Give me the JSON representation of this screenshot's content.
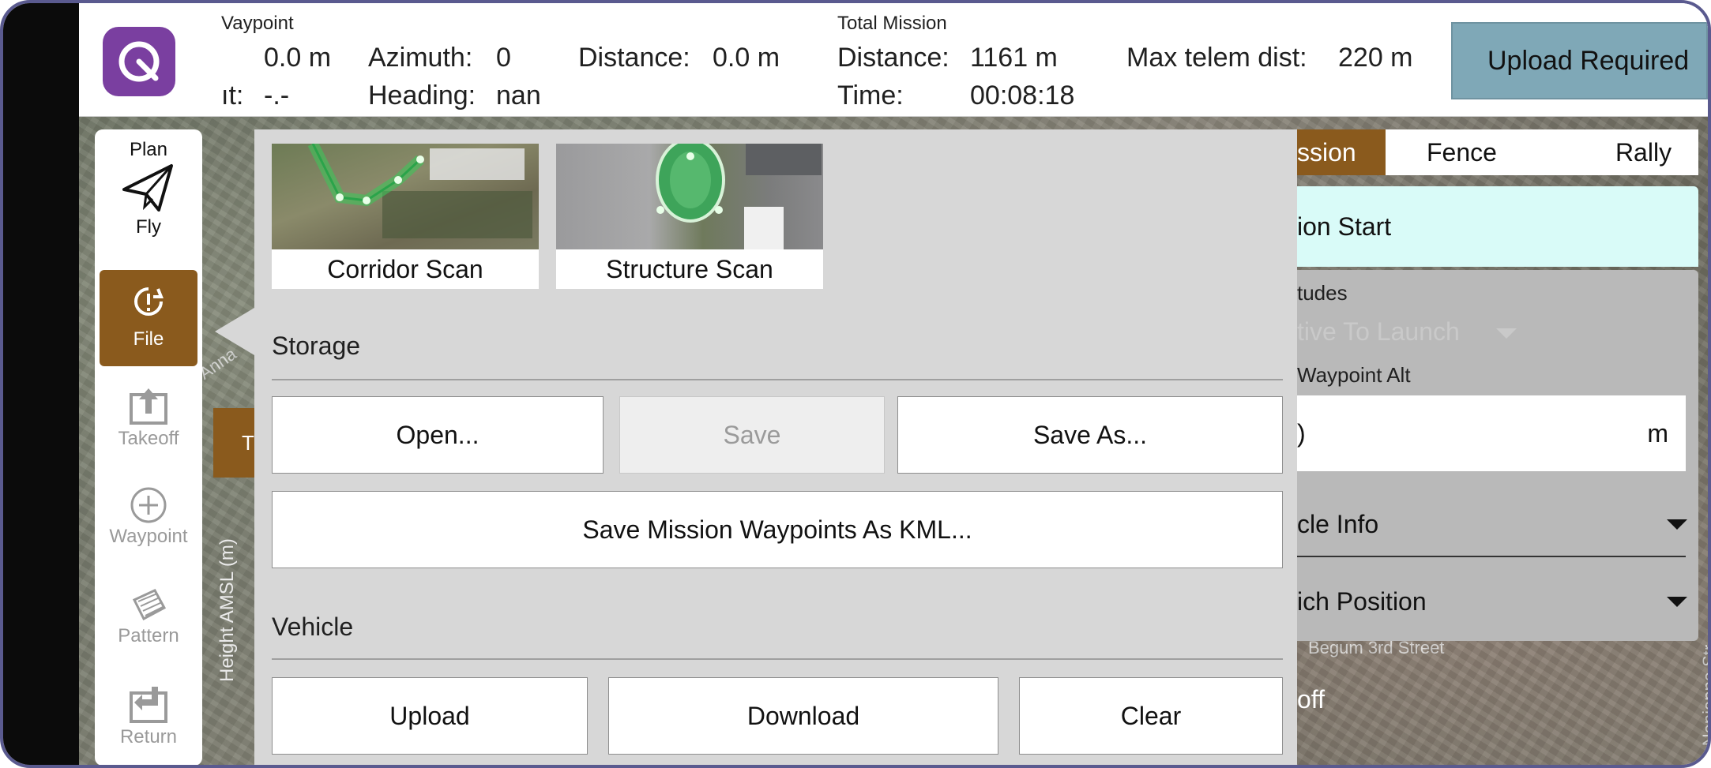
{
  "topbar": {
    "waypoint_header": "Vaypoint",
    "waypoint_alt_value": "0.0 m",
    "waypoint_grad_label": "ıt:",
    "waypoint_grad_value": "-.-",
    "azimuth_label": "Azimuth:",
    "azimuth_value": "0",
    "heading_label": "Heading:",
    "heading_value": "nan",
    "distance_label": "Distance:",
    "distance_value": "0.0 m",
    "total_header": "Total Mission",
    "total_distance_label": "Distance:",
    "total_distance_value": "1161 m",
    "total_time_label": "Time:",
    "total_time_value": "00:08:18",
    "max_telem_label": "Max telem dist:",
    "max_telem_value": "220 m",
    "upload_button": "Upload Required"
  },
  "toolbar": {
    "plan_label": "Plan",
    "fly_label": "Fly",
    "file_label": "File",
    "takeoff_label": "Takeoff",
    "waypoint_label": "Waypoint",
    "pattern_label": "Pattern",
    "return_label": "Return"
  },
  "map": {
    "height_axis_label": "Height AMSL (m)",
    "chip_label": "T",
    "road_labels": [
      "Anna",
      "Begum 3rd Street",
      "Nanjappa Str"
    ]
  },
  "popup": {
    "patterns": [
      {
        "label": "Corridor Scan"
      },
      {
        "label": "Structure Scan"
      }
    ],
    "storage_title": "Storage",
    "open_button": "Open...",
    "save_button": "Save",
    "save_as_button": "Save As...",
    "save_kml_button": "Save Mission Waypoints As KML...",
    "vehicle_title": "Vehicle",
    "upload_button": "Upload",
    "download_button": "Download",
    "clear_button": "Clear"
  },
  "right_panel": {
    "tabs": [
      "ssion",
      "Fence",
      "Rally"
    ],
    "mission_start": "ion Start",
    "altitudes_label": "tudes",
    "alt_mode": "tive To Launch",
    "waypoint_alt_label": "Waypoint Alt",
    "waypoint_alt_value": ")",
    "waypoint_alt_unit": "m",
    "vehicle_info": "cle Info",
    "launch_position": "ich Position",
    "takeoff_row": "off"
  },
  "colors": {
    "accent_brown": "#8a5a1d",
    "upload_button_bg": "#7fa8b7",
    "mission_start_bg": "#d9fbf8",
    "app_icon_bg": "#7a3fa0"
  }
}
